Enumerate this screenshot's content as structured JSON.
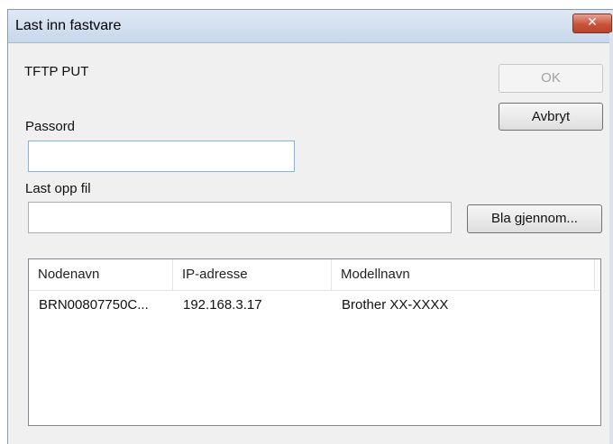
{
  "window": {
    "title": "Last inn fastvare",
    "close_glyph": "✕"
  },
  "form": {
    "protocol_label": "TFTP PUT",
    "password_label": "Passord",
    "password_value": "",
    "upload_label": "Last opp fil",
    "upload_value": ""
  },
  "buttons": {
    "ok": "OK",
    "cancel": "Avbryt",
    "browse": "Bla gjennom..."
  },
  "device_list": {
    "columns": [
      "Nodenavn",
      "IP-adresse",
      "Modellnavn"
    ],
    "rows": [
      [
        "BRN00807750C...",
        "192.168.3.17",
        "Brother XX-XXXX"
      ]
    ]
  }
}
